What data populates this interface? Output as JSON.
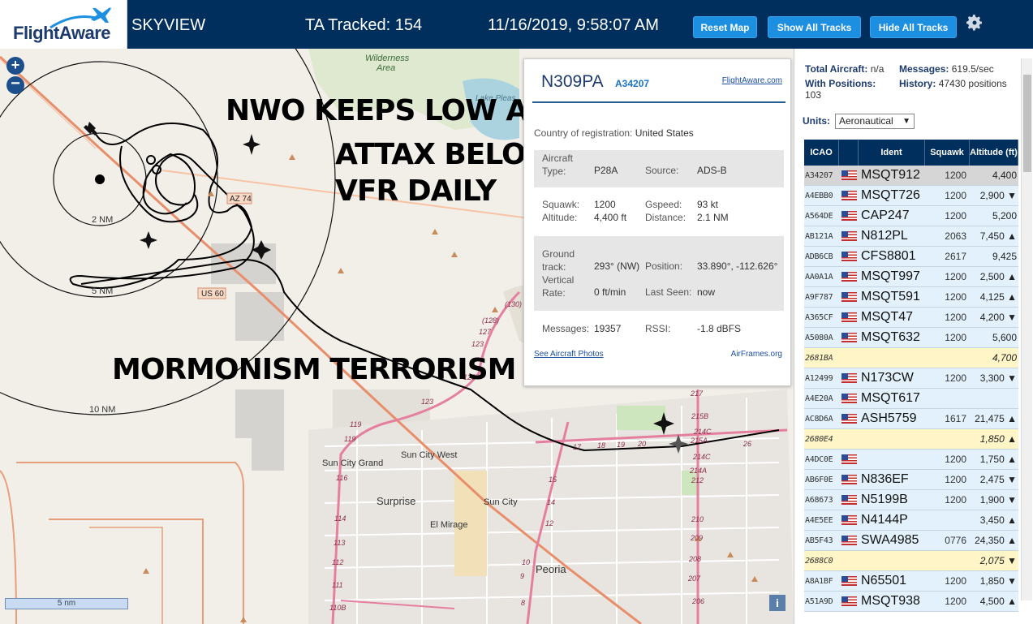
{
  "header": {
    "logo_text": "FlightAware",
    "app_title": "SKYVIEW",
    "tracked": "TA Tracked: 154",
    "datetime": "11/16/2019, 9:58:07 AM",
    "buttons": {
      "reset": "Reset Map",
      "show": "Show All Tracks",
      "hide": "Hide All Tracks"
    }
  },
  "map": {
    "overlay_text": {
      "line1": "NWO KEEPS LOW ALT",
      "line2": "ATTAX BELOW",
      "line3": "VFR DAILY",
      "line4": "MORMONISM TERRORISM"
    },
    "range_rings": [
      "2 NM",
      "5 NM",
      "10 NM"
    ],
    "places": [
      "Sun City Grand",
      "Sun City West",
      "Surprise",
      "Sun City",
      "El Mirage",
      "Peoria",
      "Wilderness Area"
    ],
    "roads": [
      "AZ 74",
      "US 60"
    ],
    "scale_label": "5 nm",
    "info_label": "i"
  },
  "popup": {
    "callsign": "N309PA",
    "hex": "A34207",
    "fa_link": "FlightAware.com",
    "country_label": "Country of registration:",
    "country": "United States",
    "aircraft_type_label": "Aircraft Type:",
    "aircraft_type": "P28A",
    "source_label": "Source:",
    "source": "ADS-B",
    "squawk_label": "Squawk:",
    "squawk": "1200",
    "gspeed_label": "Gspeed:",
    "gspeed": "93 kt",
    "altitude_label": "Altitude:",
    "altitude": "4,400 ft",
    "distance_label": "Distance:",
    "distance": "2.1 NM",
    "ground_track_label": "Ground track:",
    "ground_track": "293° (NW)",
    "position_label": "Position:",
    "position": "33.890°, -112.626°",
    "vertical_rate_label": "Vertical Rate:",
    "vertical_rate": "0 ft/min",
    "last_seen_label": "Last Seen:",
    "last_seen": "now",
    "messages_label": "Messages:",
    "messages": "19357",
    "rssi_label": "RSSI:",
    "rssi": "-1.8 dBFS",
    "photos_link": "See Aircraft Photos",
    "airframes_link": "AirFrames.org"
  },
  "sidebar": {
    "total_aircraft_label": "Total Aircraft:",
    "total_aircraft": "n/a",
    "messages_label": "Messages:",
    "messages": "619.5/sec",
    "with_positions_label": "With Positions:",
    "with_positions": "103",
    "history_label": "History:",
    "history": "47430 positions",
    "units_label": "Units:",
    "units_value": "Aeronautical",
    "columns": {
      "icao": "ICAO",
      "ident": "Ident",
      "squawk": "Squawk",
      "altitude": "Altitude (ft)"
    },
    "rows": [
      {
        "icao": "A34207",
        "ident": "MSQT912",
        "squawk": "1200",
        "alt": "4,400",
        "flag": true,
        "kind": "sel"
      },
      {
        "icao": "A4EBB0",
        "ident": "MSQT726",
        "squawk": "1200",
        "alt": "2,900 ▼",
        "flag": true,
        "kind": ""
      },
      {
        "icao": "A564DE",
        "ident": "CAP247",
        "squawk": "1200",
        "alt": "5,200",
        "flag": true,
        "kind": ""
      },
      {
        "icao": "AB121A",
        "ident": "N812PL",
        "squawk": "2063",
        "alt": "7,450 ▲",
        "flag": true,
        "kind": ""
      },
      {
        "icao": "ADB6CB",
        "ident": "CFS8801",
        "squawk": "2617",
        "alt": "9,425",
        "flag": true,
        "kind": ""
      },
      {
        "icao": "AA0A1A",
        "ident": "MSQT997",
        "squawk": "1200",
        "alt": "2,500 ▲",
        "flag": true,
        "kind": ""
      },
      {
        "icao": "A9F787",
        "ident": "MSQT591",
        "squawk": "1200",
        "alt": "4,125 ▲",
        "flag": true,
        "kind": ""
      },
      {
        "icao": "A365CF",
        "ident": "MSQT47",
        "squawk": "1200",
        "alt": "4,200 ▼",
        "flag": true,
        "kind": ""
      },
      {
        "icao": "A5080A",
        "ident": "MSQT632",
        "squawk": "1200",
        "alt": "5,600",
        "flag": true,
        "kind": ""
      },
      {
        "icao": "2681BA",
        "ident": "",
        "squawk": "",
        "alt": "4,700",
        "flag": false,
        "kind": "tisb"
      },
      {
        "icao": "A12499",
        "ident": "N173CW",
        "squawk": "1200",
        "alt": "3,300 ▼",
        "flag": true,
        "kind": ""
      },
      {
        "icao": "A4E20A",
        "ident": "MSQT617",
        "squawk": "",
        "alt": "",
        "flag": true,
        "kind": ""
      },
      {
        "icao": "AC8D6A",
        "ident": "ASH5759",
        "squawk": "1617",
        "alt": "21,475 ▲",
        "flag": true,
        "kind": ""
      },
      {
        "icao": "2680E4",
        "ident": "",
        "squawk": "",
        "alt": "1,850 ▲",
        "flag": false,
        "kind": "tisb"
      },
      {
        "icao": "A4DC0E",
        "ident": "",
        "squawk": "1200",
        "alt": "1,750 ▲",
        "flag": true,
        "kind": ""
      },
      {
        "icao": "AB6F0E",
        "ident": "N836EF",
        "squawk": "1200",
        "alt": "2,475 ▼",
        "flag": true,
        "kind": ""
      },
      {
        "icao": "A68673",
        "ident": "N5199B",
        "squawk": "1200",
        "alt": "1,900 ▼",
        "flag": true,
        "kind": ""
      },
      {
        "icao": "A4E5EE",
        "ident": "N4144P",
        "squawk": "",
        "alt": "3,450 ▲",
        "flag": true,
        "kind": ""
      },
      {
        "icao": "AB5F43",
        "ident": "SWA4985",
        "squawk": "0776",
        "alt": "24,350 ▲",
        "flag": true,
        "kind": ""
      },
      {
        "icao": "2688C0",
        "ident": "",
        "squawk": "",
        "alt": "2,075 ▼",
        "flag": false,
        "kind": "tisb"
      },
      {
        "icao": "A8A1BF",
        "ident": "N65501",
        "squawk": "1200",
        "alt": "1,850 ▼",
        "flag": true,
        "kind": ""
      },
      {
        "icao": "A51A9D",
        "ident": "MSQT938",
        "squawk": "1200",
        "alt": "4,500 ▲",
        "flag": true,
        "kind": ""
      }
    ]
  },
  "colors": {
    "header_bg": "#002f5d",
    "button_bg": "#1c8fe0",
    "row_bg": "#e2f1fb",
    "tisb_bg": "#fff5c6",
    "selected_bg": "#d6d6d6"
  }
}
